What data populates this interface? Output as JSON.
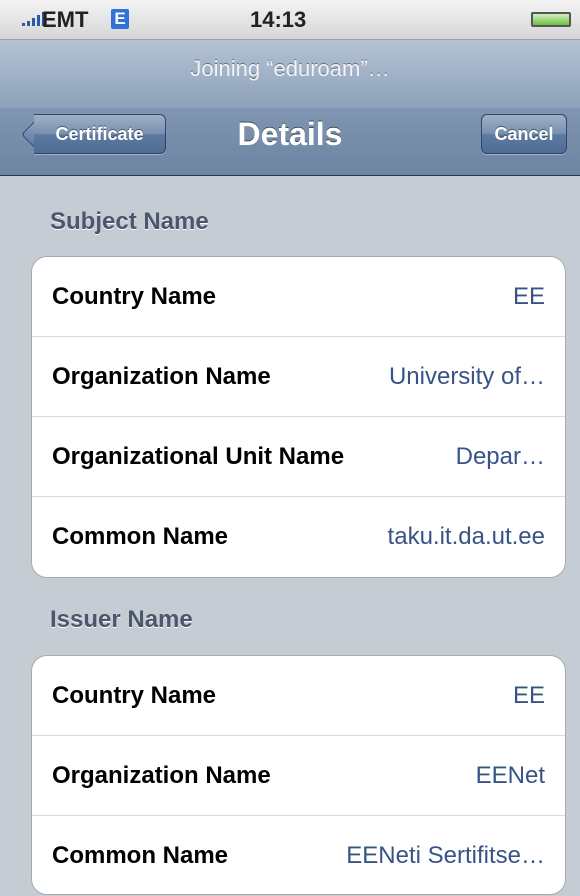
{
  "status_bar": {
    "carrier": "EMT",
    "network_type": "E",
    "time": "14:13",
    "signal_icon": "signal-bars-icon",
    "battery_icon": "battery-icon"
  },
  "nav": {
    "prompt": "Joining “eduroam”…",
    "title": "Details",
    "back_label": "Certificate",
    "cancel_label": "Cancel"
  },
  "subject": {
    "header": "Subject Name",
    "rows": [
      {
        "label": "Country Name",
        "value": "EE"
      },
      {
        "label": "Organization Name",
        "value": "University of…"
      },
      {
        "label": "Organizational Unit Name",
        "value": "Depar…"
      },
      {
        "label": "Common Name",
        "value": "taku.it.da.ut.ee"
      }
    ]
  },
  "issuer": {
    "header": "Issuer Name",
    "rows": [
      {
        "label": "Country Name",
        "value": "EE"
      },
      {
        "label": "Organization Name",
        "value": "EENet"
      },
      {
        "label": "Common Name",
        "value": "EENeti Sertifitse…"
      }
    ]
  },
  "colors": {
    "value_text": "#385487",
    "background": "#c5ccd4",
    "nav_bar": "#7f95b1"
  }
}
